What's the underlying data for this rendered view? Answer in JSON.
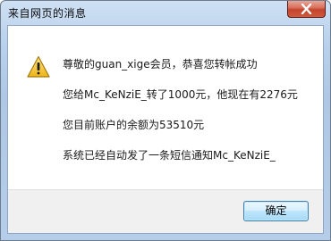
{
  "window": {
    "title": "来自网页的消息"
  },
  "dialog": {
    "messages": [
      "尊敬的guan_xige会员，恭喜您转帐成功",
      "您给Mc_KeNziE_转了1000元，他现在有2276元",
      "您目前账户的余额为53510元",
      "系统已经自动发了一条短信通知Mc_KeNziE_"
    ],
    "icon": "warning-icon",
    "ok_label": "确定"
  },
  "colors": {
    "close_button": "#c5432c",
    "warning_fill": "#f6c32e"
  }
}
